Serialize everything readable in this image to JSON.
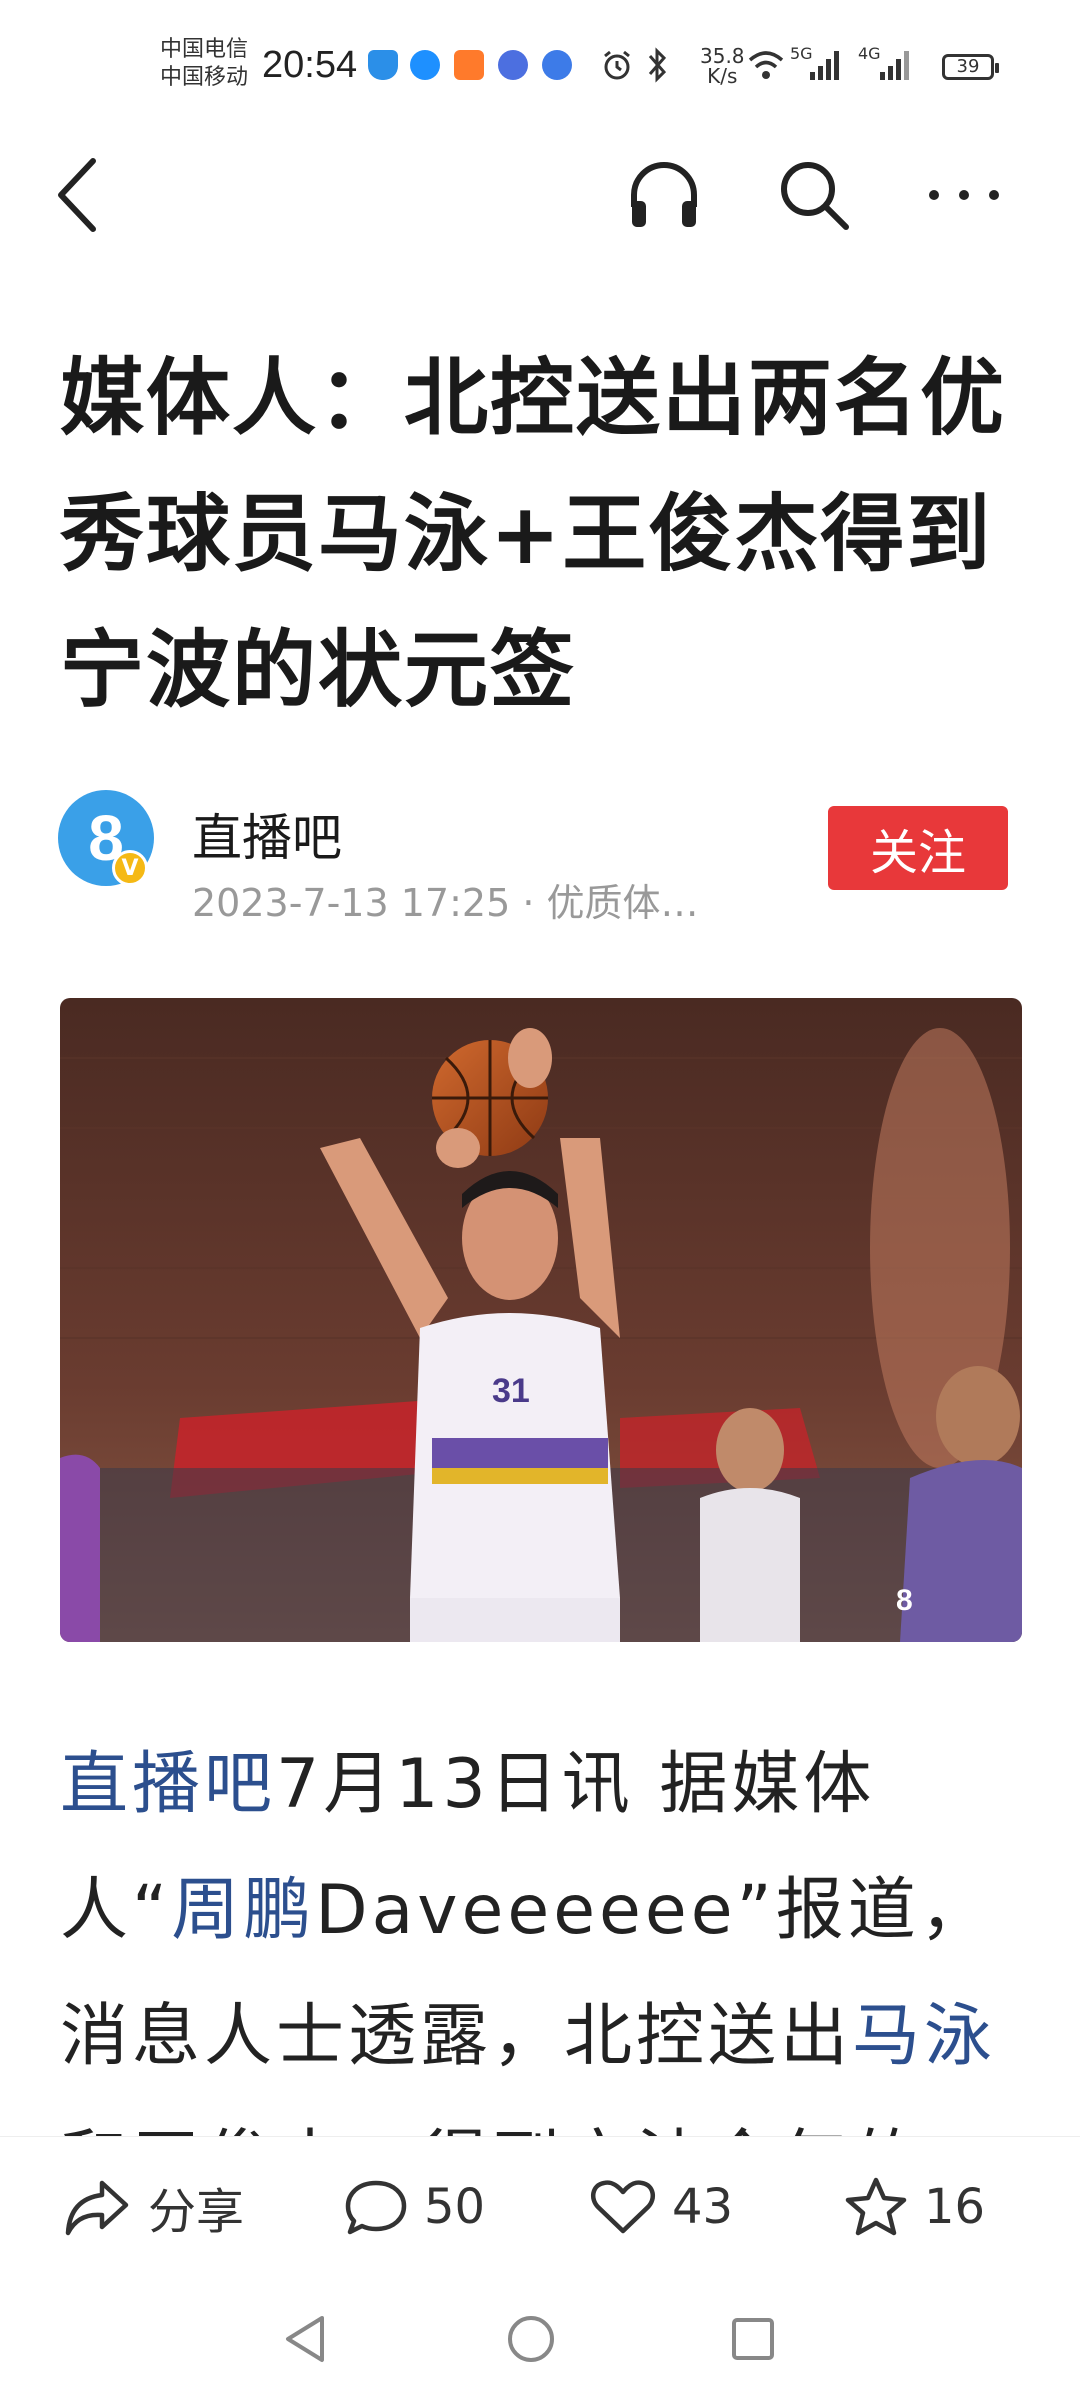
{
  "status_bar": {
    "carrier_1": "中国电信",
    "carrier_2": "中国移动",
    "time": "20:54",
    "net_speed_value": "35.8",
    "net_speed_unit": "K/s",
    "signal_1": "5G",
    "signal_2": "4G",
    "battery": "39"
  },
  "article": {
    "title": "媒体人：北控送出两名优秀球员马泳+王俊杰得到宁波的状元签",
    "author": "直播吧",
    "meta": "2023-7-13 17:25 · 优质体…",
    "follow_label": "关注",
    "image_jersey_number": "31",
    "body": {
      "link_1": "直播吧",
      "text_1": "7月13日讯 据媒体人“",
      "link_2": "周鹏",
      "text_2": "Daveeeeee”报道，消息人士透露，北控送出",
      "link_3": "马泳",
      "text_3": "和王俊杰，得到宁波今年的"
    }
  },
  "actions": {
    "share_label": "分享",
    "comments": "50",
    "likes": "43",
    "favorites": "16"
  },
  "colors": {
    "follow_bg": "#e8383a",
    "link": "#2c4f8e",
    "avatar": "#3aa0e8"
  }
}
